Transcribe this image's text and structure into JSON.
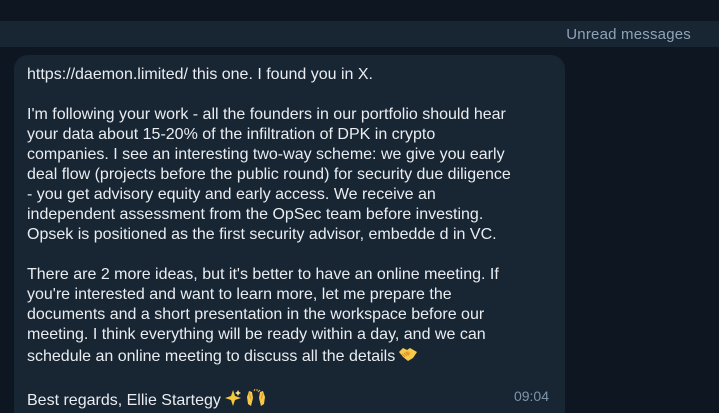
{
  "unread": {
    "label": "Unread messages"
  },
  "message": {
    "link": "https://daemon.limited/",
    "link_suffix": " this one. I found you in X.",
    "paragraph_1_line_1": "I'm following your work - all the founders in our portfolio should hear",
    "paragraph_1_line_2": "your data about 15-20% of the infiltration of DPK in crypto",
    "paragraph_1_line_3": "companies. I see an interesting two-way scheme: we give you early",
    "paragraph_1_line_4": "deal flow (projects before the public round) for security due diligence",
    "paragraph_1_line_5": "- you get advisory equity and early access. We receive an",
    "paragraph_1_line_6": "independent assessment from the OpSec team before investing.",
    "paragraph_1_line_7": "Opsek is positioned as the first security advisor, embedde d in VC.",
    "paragraph_2_line_1": "There are 2 more ideas, but it's better to have an online meeting. If",
    "paragraph_2_line_2": "you're interested and want to learn more, let me prepare the",
    "paragraph_2_line_3": "documents and a short presentation in the workspace before our",
    "paragraph_2_line_4": "meeting. I think everything will be ready within a day, and we can",
    "paragraph_2_line_5": "schedule an online meeting to discuss all the details",
    "signature": "Best regards, Ellie Startegy",
    "time": "09:04",
    "icons": {
      "handshake": "handshake-emoji",
      "sparkles": "sparkles-emoji",
      "raised_hands": "raised-hands-emoji"
    },
    "colors": {
      "background": "#0e1621",
      "bubble": "#182533",
      "text": "#e9edf1",
      "meta": "#8094a8"
    }
  }
}
